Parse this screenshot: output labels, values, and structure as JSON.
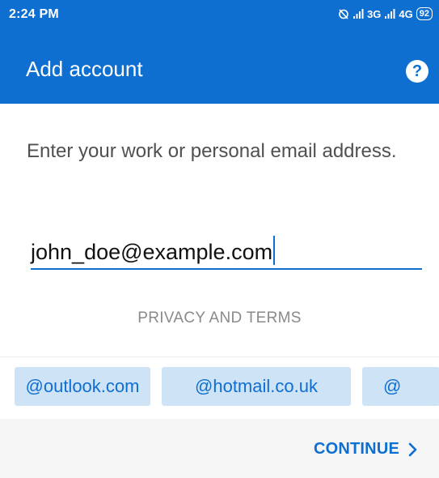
{
  "status_bar": {
    "time": "2:24 PM",
    "network_text": "3G",
    "network_text_2": "4G",
    "battery": "92"
  },
  "app_bar": {
    "title": "Add account",
    "help_icon": "?"
  },
  "prompt": "Enter your work or personal email address.",
  "email_input": {
    "value": "john_doe@example.com"
  },
  "privacy_link": "PRIVACY AND TERMS",
  "domain_chips": [
    "@outlook.com",
    "@hotmail.co.uk",
    "@"
  ],
  "continue_label": "CONTINUE",
  "colors": {
    "accent": "#0e6fd0",
    "chip_bg": "#cfe3f7",
    "bottom_bar_bg": "#f5f5f5"
  }
}
